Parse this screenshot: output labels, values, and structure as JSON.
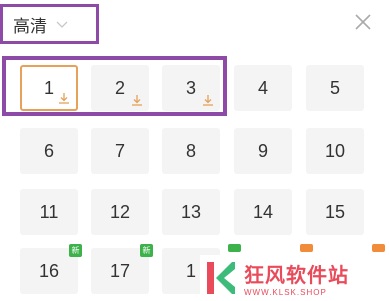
{
  "header": {
    "quality_label": "高清",
    "close_icon": "close-icon",
    "chevron_icon": "chevron-down-icon"
  },
  "episodes": [
    {
      "num": "1",
      "downloaded": true,
      "active": true
    },
    {
      "num": "2",
      "downloaded": true
    },
    {
      "num": "3",
      "downloaded": true
    },
    {
      "num": "4"
    },
    {
      "num": "5"
    },
    {
      "num": "6"
    },
    {
      "num": "7"
    },
    {
      "num": "8"
    },
    {
      "num": "9"
    },
    {
      "num": "10"
    },
    {
      "num": "11"
    },
    {
      "num": "12"
    },
    {
      "num": "13"
    },
    {
      "num": "14"
    },
    {
      "num": "15"
    },
    {
      "num": "16",
      "badge": "new"
    },
    {
      "num": "17",
      "badge": "new"
    },
    {
      "num": "1"
    }
  ],
  "badge_text": "新",
  "colors": {
    "highlight": "#8e4aa7",
    "accent": "#e6a15a",
    "badge_green": "#3db14a",
    "badge_orange": "#f08c3a",
    "cell_bg": "#f4f4f4"
  },
  "watermark": {
    "title": "狂风软件站",
    "subtitle": "WWW.KLSK.SHOP"
  }
}
